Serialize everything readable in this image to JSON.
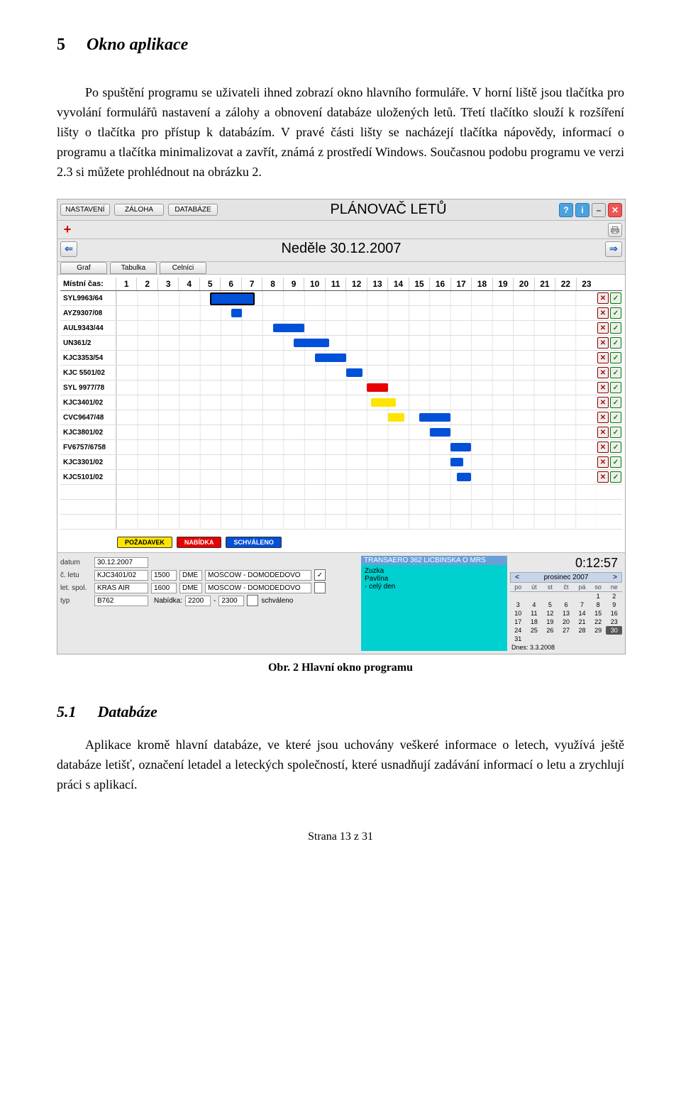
{
  "doc": {
    "h1_num": "5",
    "h1_title": "Okno aplikace",
    "para1": "Po spuštění programu se uživateli ihned zobrazí okno hlavního formuláře. V horní liště jsou tlačítka pro vyvolání formulářů nastavení a zálohy a obnovení databáze uložených letů. Třetí tlačítko slouží k rozšíření lišty o tlačítka pro přístup k databázím. V pravé části lišty se nacházejí tlačítka nápovědy, informací o programu a tlačítka minimalizovat a zavřít, známá z prostředí Windows. Současnou podobu programu ve verzi 2.3 si můžete prohlédnout na obrázku 2.",
    "caption": "Obr. 2 Hlavní okno programu",
    "h2_num": "5.1",
    "h2_title": "Databáze",
    "para2": "Aplikace kromě hlavní databáze, ve které jsou uchovány veškeré informace o letech, využívá ještě databáze letišť, označení letadel a leteckých společností, které usnadňují zadávání informací o letu a zrychlují práci s aplikací.",
    "footer": "Strana 13 z 31"
  },
  "app": {
    "toolbar": {
      "nastaveni": "NASTAVENÍ",
      "zaloha": "ZÁLOHA",
      "databaze": "DATABÁZE",
      "title": "PLÁNOVAČ LETŮ",
      "help": "?",
      "info": "i",
      "min": "–",
      "close": "✕"
    },
    "plus": "+",
    "date_label": "Neděle 30.12.2007",
    "arrow_left": "⇐",
    "arrow_right": "⇒",
    "tabs": {
      "graf": "Graf",
      "tabulka": "Tabulka",
      "celnici": "Celníci"
    },
    "axis_label": "Místní čas:",
    "hours": [
      "1",
      "2",
      "3",
      "4",
      "5",
      "6",
      "7",
      "8",
      "9",
      "10",
      "11",
      "12",
      "13",
      "14",
      "15",
      "16",
      "17",
      "18",
      "19",
      "20",
      "21",
      "22",
      "23"
    ],
    "flights": [
      {
        "label": "SYL9963/64",
        "bars": [
          {
            "start": 5.5,
            "end": 7.5,
            "color": "#0050d8",
            "sel": true
          }
        ],
        "actions": true
      },
      {
        "label": "AYZ9307/08",
        "bars": [
          {
            "start": 6.5,
            "end": 7.0,
            "color": "#0050d8"
          }
        ],
        "actions": true
      },
      {
        "label": "AUL9343/44",
        "bars": [
          {
            "start": 8.5,
            "end": 10.0,
            "color": "#0050d8"
          }
        ],
        "actions": true
      },
      {
        "label": "UN361/2",
        "bars": [
          {
            "start": 9.5,
            "end": 11.2,
            "color": "#0050d8"
          }
        ],
        "actions": true
      },
      {
        "label": "KJC3353/54",
        "bars": [
          {
            "start": 10.5,
            "end": 12.0,
            "color": "#0050d8"
          }
        ],
        "actions": true
      },
      {
        "label": "KJC 5501/02",
        "bars": [
          {
            "start": 12.0,
            "end": 12.8,
            "color": "#0050d8"
          }
        ],
        "actions": true
      },
      {
        "label": "SYL 9977/78",
        "bars": [
          {
            "start": 13.0,
            "end": 14.0,
            "color": "#e80000"
          }
        ],
        "actions": true
      },
      {
        "label": "KJC3401/02",
        "bars": [
          {
            "start": 13.2,
            "end": 14.4,
            "color": "#ffe400"
          }
        ],
        "actions": true
      },
      {
        "label": "CVC9647/48",
        "bars": [
          {
            "start": 14.0,
            "end": 14.8,
            "color": "#ffe400"
          },
          {
            "start": 15.5,
            "end": 17.0,
            "color": "#0050d8"
          }
        ],
        "actions": true
      },
      {
        "label": "KJC3801/02",
        "bars": [
          {
            "start": 16.0,
            "end": 17.0,
            "color": "#0050d8"
          }
        ],
        "actions": true
      },
      {
        "label": "FV6757/6758",
        "bars": [
          {
            "start": 17.0,
            "end": 18.0,
            "color": "#0050d8"
          }
        ],
        "actions": true
      },
      {
        "label": "KJC3301/02",
        "bars": [
          {
            "start": 17.0,
            "end": 17.6,
            "color": "#0050d8"
          }
        ],
        "actions": true
      },
      {
        "label": "KJC5101/02",
        "bars": [
          {
            "start": 17.3,
            "end": 18.0,
            "color": "#0050d8"
          }
        ],
        "actions": true
      },
      {
        "label": "",
        "bars": [],
        "actions": false
      },
      {
        "label": "",
        "bars": [],
        "actions": false
      },
      {
        "label": "",
        "bars": [],
        "actions": false
      }
    ],
    "legend": {
      "pozadavek": "POŽADAVEK",
      "nabidka": "NABÍDKA",
      "schvaleno": "SCHVÁLENO"
    },
    "form": {
      "l_datum": "datum",
      "v_datum": "30.12.2007",
      "l_cletu": "č. letu",
      "v_cletu": "KJC3401/02",
      "v_t1": "1500",
      "v_code1": "DME",
      "v_dest1": "MOSCOW - DOMODEDOVO",
      "cb1": "✓",
      "l_letspol": "let. spol.",
      "v_letspol": "KRAS AIR",
      "v_t2": "1600",
      "v_code2": "DME",
      "v_dest2": "MOSCOW - DOMODEDOVO",
      "cb2": "",
      "l_typ": "typ",
      "v_typ": "B762",
      "l_nabidka": "Nabídka:",
      "v_nab1": "2200",
      "v_nabdash": "-",
      "v_nab2": "2300",
      "l_schvaleno": "schváleno"
    },
    "info": {
      "title": "TRANSAERO 362 LICBINSKA O MRS",
      "line1": "Zuzka",
      "line2": "Pavlína",
      "line3": "- celý den"
    },
    "calendar": {
      "time": "0:12:57",
      "nav_prev": "<",
      "nav_next": ">",
      "title": "prosinec 2007",
      "dow": [
        "po",
        "út",
        "st",
        "čt",
        "pá",
        "so",
        "ne"
      ],
      "days": [
        "",
        "",
        "",
        "",
        "",
        "1",
        "2",
        "3",
        "4",
        "5",
        "6",
        "7",
        "8",
        "9",
        "10",
        "11",
        "12",
        "13",
        "14",
        "15",
        "16",
        "17",
        "18",
        "19",
        "20",
        "21",
        "22",
        "23",
        "24",
        "25",
        "26",
        "27",
        "28",
        "29",
        "30",
        "31",
        "",
        "",
        "",
        "",
        "",
        ""
      ],
      "highlight": "30",
      "today": "Dnes: 3.3.2008"
    }
  }
}
